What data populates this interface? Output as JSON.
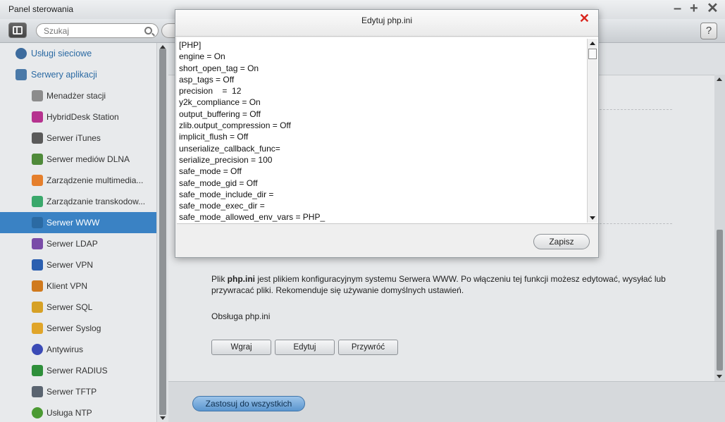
{
  "window": {
    "title": "Panel sterowania"
  },
  "toolbar": {
    "search_placeholder": "Szukaj",
    "help_label": "?"
  },
  "sidebar": {
    "items": [
      {
        "label": "Usługi sieciowe",
        "icon": "globe-icon",
        "color": "#3d6c9e",
        "group": true
      },
      {
        "label": "Serwery aplikacji",
        "icon": "server-icon",
        "color": "#4a79a8",
        "group": true
      },
      {
        "label": "Menadżer stacji",
        "icon": "station-icon",
        "color": "#8c8c8c"
      },
      {
        "label": "HybridDesk Station",
        "icon": "hd-icon",
        "color": "#b6338f"
      },
      {
        "label": "Serwer iTunes",
        "icon": "itunes-icon",
        "color": "#5a5a5a"
      },
      {
        "label": "Serwer mediów DLNA",
        "icon": "dlna-icon",
        "color": "#4f8a3a"
      },
      {
        "label": "Zarządzenie multimedia...",
        "icon": "multimedia-icon",
        "color": "#e57f2c"
      },
      {
        "label": "Zarządzanie transkodow...",
        "icon": "transcode-icon",
        "color": "#3aa86b"
      },
      {
        "label": "Serwer WWW",
        "icon": "www-icon",
        "color": "#2b6aa3",
        "active": true
      },
      {
        "label": "Serwer LDAP",
        "icon": "ldap-icon",
        "color": "#7a4ca8"
      },
      {
        "label": "Serwer VPN",
        "icon": "vpn-icon",
        "color": "#2b5fb0"
      },
      {
        "label": "Klient VPN",
        "icon": "lock-icon",
        "color": "#d07a1e"
      },
      {
        "label": "Serwer SQL",
        "icon": "database-icon",
        "color": "#d6a126"
      },
      {
        "label": "Serwer Syslog",
        "icon": "mail-icon",
        "color": "#e0a52a"
      },
      {
        "label": "Antywirus",
        "icon": "antivirus-icon",
        "color": "#3b4bb6"
      },
      {
        "label": "Serwer RADIUS",
        "icon": "wifi-icon",
        "color": "#2e8f3a"
      },
      {
        "label": "Serwer TFTP",
        "icon": "tftp-icon",
        "color": "#5a6470"
      },
      {
        "label": "Usługa NTP",
        "icon": "clock-icon",
        "color": "#4b9a33"
      }
    ]
  },
  "main": {
    "description_prefix": "Plik ",
    "description_bold": "php.ini",
    "description_suffix": " jest plikiem konfiguracyjnym systemu Serwera WWW. Po włączeniu tej funkcji możesz edytować, wysyłać lub przywracać pliki. Rekomenduje się używanie domyślnych ustawień.",
    "php_label": "Obsługa php.ini",
    "buttons": {
      "upload": "Wgraj",
      "edit": "Edytuj",
      "restore": "Przywróć"
    },
    "apply_all": "Zastosuj do wszystkich"
  },
  "dialog": {
    "title": "Edytuj php.ini",
    "close_label": "✕",
    "save_label": "Zapisz",
    "lines": [
      "[PHP]",
      "engine = On",
      "short_open_tag = On",
      "asp_tags = Off",
      "precision    =  12",
      "y2k_compliance = On",
      "output_buffering = Off",
      "zlib.output_compression = Off",
      "implicit_flush = Off",
      "unserialize_callback_func=",
      "serialize_precision = 100",
      "safe_mode = Off",
      "safe_mode_gid = Off",
      "safe_mode_include_dir =",
      "safe_mode_exec_dir =",
      "safe_mode_allowed_env_vars = PHP_"
    ]
  },
  "colors": {
    "accent": "#3a82c4",
    "close_red": "#d9241c"
  }
}
